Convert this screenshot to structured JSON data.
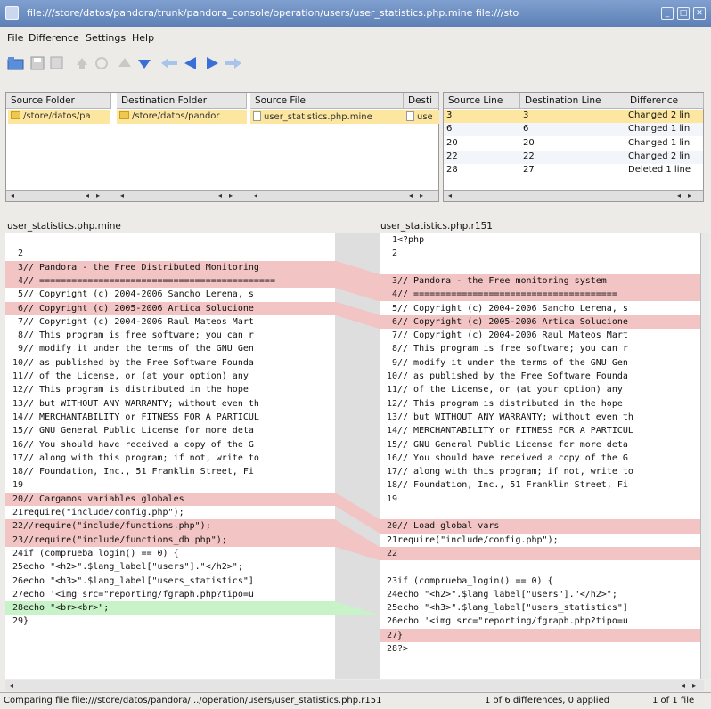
{
  "window": {
    "title": "file:///store/datos/pandora/trunk/pandora_console/operation/users/user_statistics.php.mine file:///sto"
  },
  "menu": [
    "File",
    "Difference",
    "Settings",
    "Help"
  ],
  "files": {
    "headers": [
      "Source Folder",
      "Destination Folder",
      "Source File",
      "Desti"
    ],
    "row": [
      "/store/datos/pa",
      "/store/datos/pandor",
      "user_statistics.php.mine",
      "use"
    ]
  },
  "diffs": {
    "headers": [
      "Source Line",
      "Destination Line",
      "Difference"
    ],
    "rows": [
      [
        "3",
        "3",
        "Changed 2 lin"
      ],
      [
        "6",
        "6",
        "Changed 1 lin"
      ],
      [
        "20",
        "20",
        "Changed 1 lin"
      ],
      [
        "22",
        "22",
        "Changed 2 lin"
      ],
      [
        "28",
        "27",
        "Deleted 1 line"
      ]
    ]
  },
  "left": {
    "filename": "user_statistics.php.mine",
    "lines": [
      [
        "",
        ""
      ],
      [
        "2",
        ""
      ],
      [
        "3",
        "// Pandora - the Free Distributed Monitoring"
      ],
      [
        "4",
        "// ============================================"
      ],
      [
        "5",
        "// Copyright (c) 2004-2006 Sancho Lerena, s"
      ],
      [
        "6",
        "// Copyright (c) 2005-2006 Artica Solucione"
      ],
      [
        "7",
        "// Copyright (c) 2004-2006 Raul Mateos Mart"
      ],
      [
        "8",
        "// This program is free software; you can r"
      ],
      [
        "9",
        "// modify it under the terms of the GNU Gen"
      ],
      [
        "10",
        "// as published by the Free Software Founda"
      ],
      [
        "11",
        "// of the License, or (at your option) any"
      ],
      [
        "12",
        "// This program is distributed in the hope"
      ],
      [
        "13",
        "// but WITHOUT ANY WARRANTY; without even th"
      ],
      [
        "14",
        "// MERCHANTABILITY or FITNESS FOR A PARTICUL"
      ],
      [
        "15",
        "// GNU General Public License for more deta"
      ],
      [
        "16",
        "// You should have received a copy of the G"
      ],
      [
        "17",
        "// along with this program; if not, write to"
      ],
      [
        "18",
        "// Foundation, Inc., 51 Franklin Street, Fi"
      ],
      [
        "19",
        ""
      ],
      [
        "20",
        "// Cargamos variables globales"
      ],
      [
        "21",
        "require(\"include/config.php\");"
      ],
      [
        "22",
        "//require(\"include/functions.php\");"
      ],
      [
        "23",
        "//require(\"include/functions_db.php\");"
      ],
      [
        "24",
        "if (comprueba_login() == 0) {"
      ],
      [
        "25",
        "echo \"<h2>\".$lang_label[\"users\"].\"</h2>\";"
      ],
      [
        "26",
        "echo \"<h3>\".$lang_label[\"users_statistics\"]"
      ],
      [
        "27",
        "echo '<img src=\"reporting/fgraph.php?tipo=u"
      ],
      [
        "28",
        "echo \"<br><br>\";"
      ],
      [
        "29",
        "}"
      ]
    ]
  },
  "right": {
    "filename": "user_statistics.php.r151",
    "lines": [
      [
        "1",
        "<?php"
      ],
      [
        "2",
        ""
      ],
      [
        "",
        ""
      ],
      [
        "3",
        "// Pandora - the Free monitoring system"
      ],
      [
        "4",
        "// ======================================"
      ],
      [
        "5",
        "// Copyright (c) 2004-2006 Sancho Lerena, s"
      ],
      [
        "6",
        "// Copyright (c) 2005-2006 Artica Solucione"
      ],
      [
        "7",
        "// Copyright (c) 2004-2006 Raul Mateos Mart"
      ],
      [
        "8",
        "// This program is free software; you can r"
      ],
      [
        "9",
        "// modify it under the terms of the GNU Gen"
      ],
      [
        "10",
        "// as published by the Free Software Founda"
      ],
      [
        "11",
        "// of the License, or (at your option) any"
      ],
      [
        "12",
        "// This program is distributed in the hope"
      ],
      [
        "13",
        "// but WITHOUT ANY WARRANTY; without even th"
      ],
      [
        "14",
        "// MERCHANTABILITY or FITNESS FOR A PARTICUL"
      ],
      [
        "15",
        "// GNU General Public License for more deta"
      ],
      [
        "16",
        "// You should have received a copy of the G"
      ],
      [
        "17",
        "// along with this program; if not, write to"
      ],
      [
        "18",
        "// Foundation, Inc., 51 Franklin Street, Fi"
      ],
      [
        "19",
        ""
      ],
      [
        "",
        ""
      ],
      [
        "20",
        "// Load global vars"
      ],
      [
        "21",
        "require(\"include/config.php\");"
      ],
      [
        "22",
        ""
      ],
      [
        "",
        ""
      ],
      [
        "23",
        "if (comprueba_login() == 0) {"
      ],
      [
        "24",
        "echo \"<h2>\".$lang_label[\"users\"].\"</h2>\";"
      ],
      [
        "25",
        "echo \"<h3>\".$lang_label[\"users_statistics\"]"
      ],
      [
        "26",
        "echo '<img src=\"reporting/fgraph.php?tipo=u"
      ],
      [
        "27",
        "}"
      ],
      [
        "28",
        "?>"
      ]
    ]
  },
  "status": {
    "file": "Comparing file file:///store/datos/pandora/.../operation/users/user_statistics.php.r151",
    "count": "1 of 6 differences, 0 applied",
    "files": "1 of 1 file"
  },
  "colors": {
    "changed": "#f2c4c4",
    "inserted": "#c8f2c8",
    "selected": "#fde7a0",
    "rail": "#dedede"
  }
}
